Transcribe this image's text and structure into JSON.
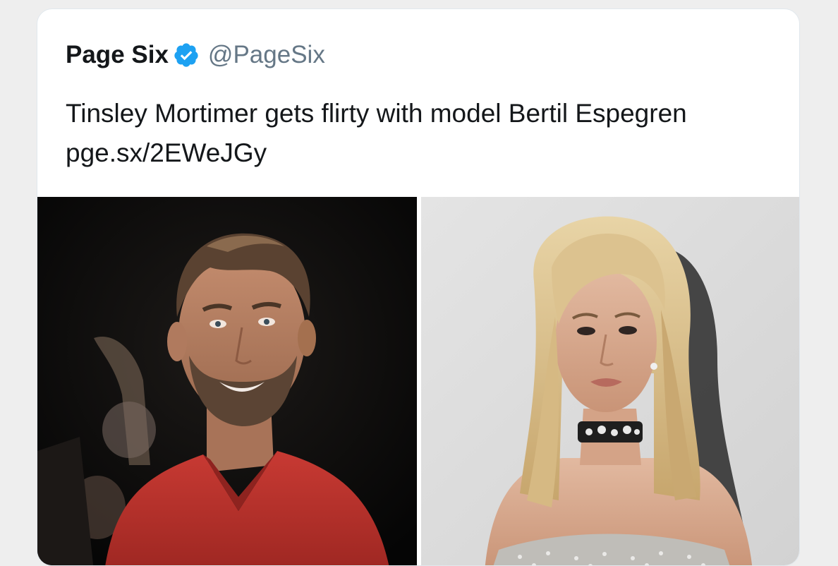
{
  "tweet": {
    "author_name": "Page Six",
    "author_handle": "@PageSix",
    "verified_icon": "verified-badge-icon",
    "text_main": "Tinsley Mortimer gets flirty with model Bertil Espegren ",
    "text_link": "pge.sx/2EWeJGy",
    "accent_color": "#1da1f2"
  },
  "media": {
    "photos": [
      {
        "name": "photo-man-red-shirt",
        "background": "#0c0c0c"
      },
      {
        "name": "photo-woman-blonde",
        "background": "#dcdcdc"
      }
    ]
  }
}
